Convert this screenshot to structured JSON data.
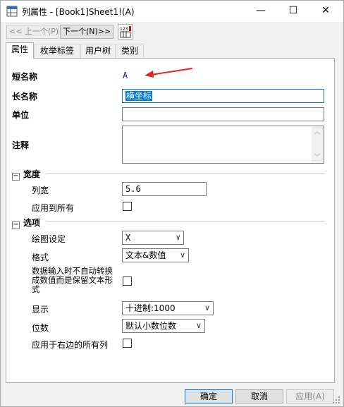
{
  "window": {
    "title": "列属性 - [Book1]Sheet1!(A)",
    "controls": {
      "minimize": "—",
      "maximize": "☐",
      "close": "✕"
    }
  },
  "toolbar": {
    "prev_label": "<< 上一个(P)",
    "next_label": "下一个(N)>>",
    "colinfo_icon_text": "123"
  },
  "tabs": [
    {
      "label": "属性",
      "active": true
    },
    {
      "label": "枚举标签",
      "active": false
    },
    {
      "label": "用户树",
      "active": false
    },
    {
      "label": "类别",
      "active": false
    }
  ],
  "properties": {
    "short_name": {
      "label": "短名称",
      "value": "A"
    },
    "long_name": {
      "label": "长名称",
      "value": "横坐标"
    },
    "units": {
      "label": "单位",
      "value": ""
    },
    "comments": {
      "label": "注释",
      "value": ""
    }
  },
  "width_section": {
    "header": "宽度",
    "column_width": {
      "label": "列宽",
      "value": "5.6"
    },
    "apply_to_all": {
      "label": "应用到所有",
      "checked": false
    }
  },
  "options_section": {
    "header": "选项",
    "plot_designation": {
      "label": "绘图设定",
      "value": "X"
    },
    "format": {
      "label": "格式",
      "value": "文本&数值"
    },
    "keep_text": {
      "label_line1": "数据输入时不自动转换",
      "label_line2": "成数值而是保留文本形",
      "label_line3": "式",
      "checked": false
    },
    "display": {
      "label": "显示",
      "value": "十进制:1000"
    },
    "digits": {
      "label": "位数",
      "value": "默认小数位数"
    },
    "apply_right": {
      "label": "应用于右边的所有列",
      "checked": false
    }
  },
  "buttons": {
    "ok": "确定",
    "cancel": "取消",
    "apply": "应用(A)"
  },
  "colors": {
    "selection": "#0078d7",
    "short_name_text": "#1a1aa6",
    "annotation_arrow": "#e8251f"
  }
}
